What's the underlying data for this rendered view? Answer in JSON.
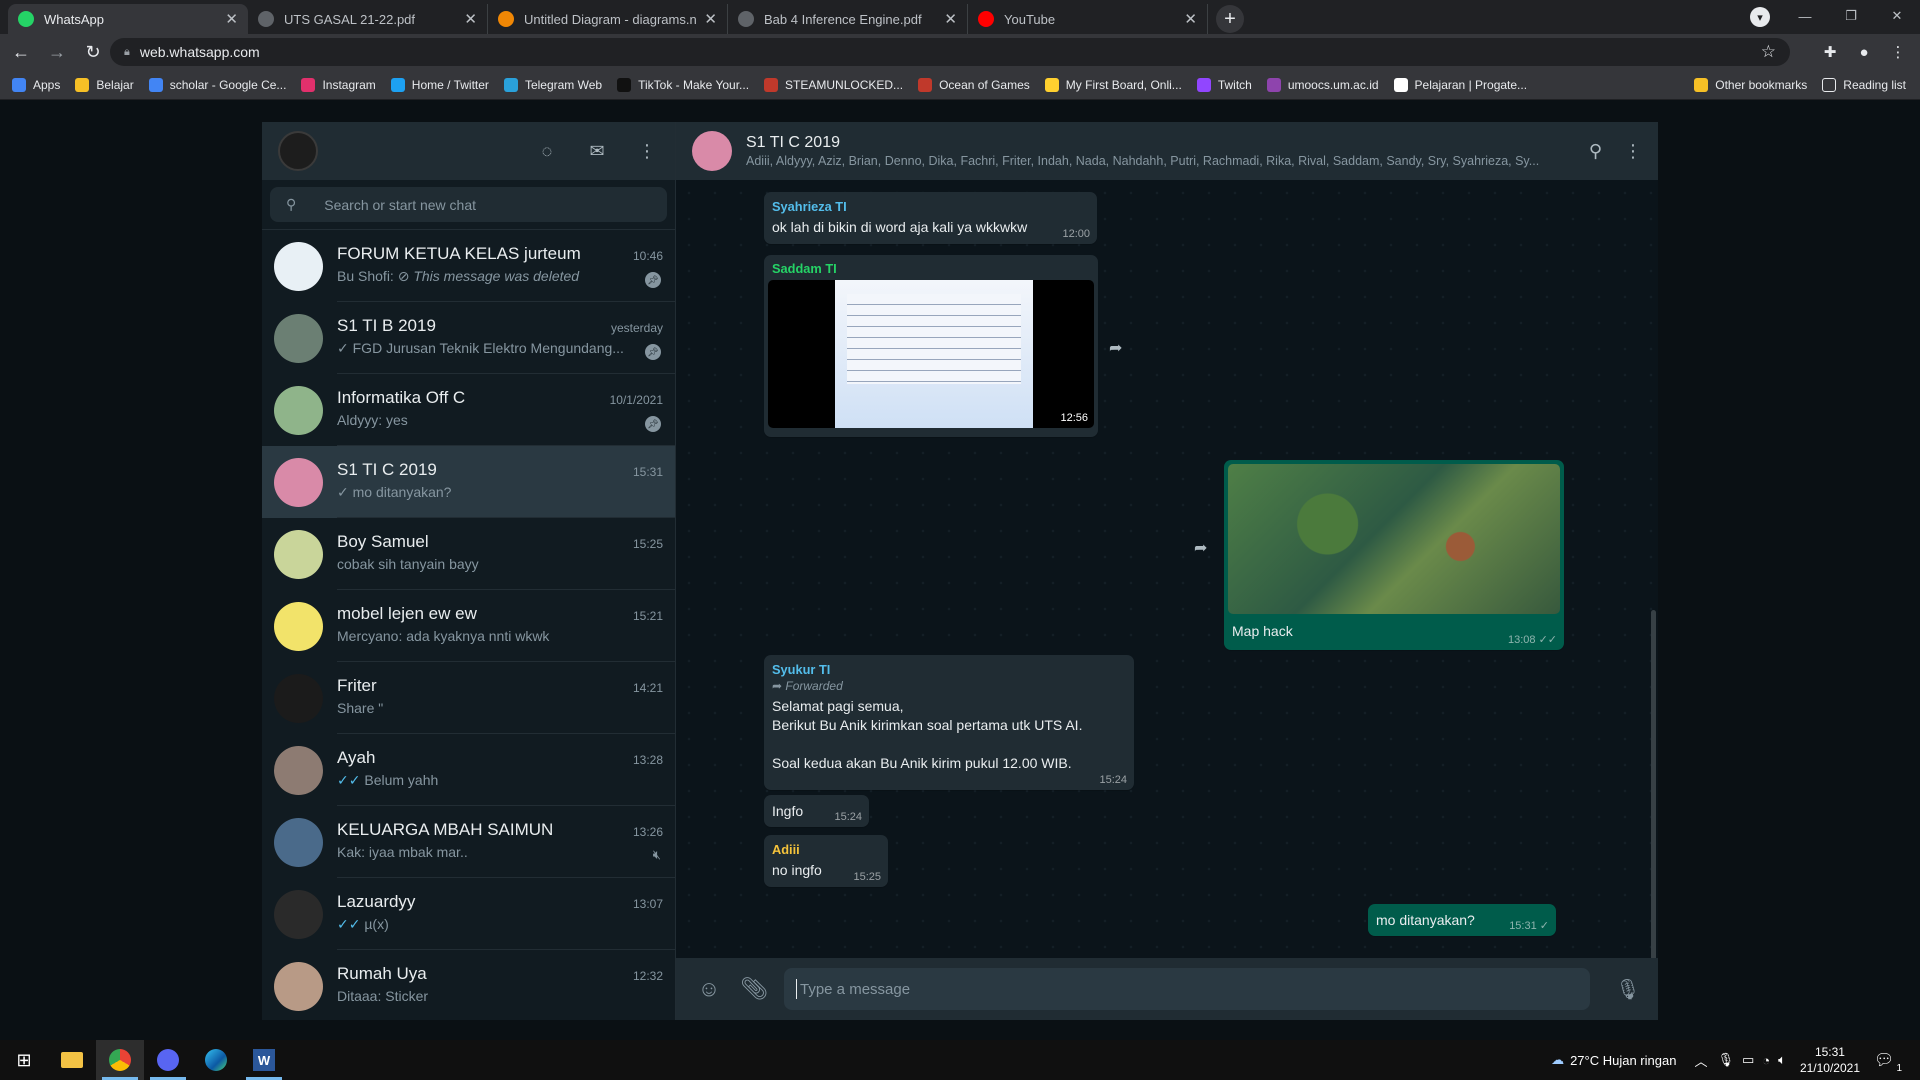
{
  "browser": {
    "tabs": [
      {
        "title": "WhatsApp",
        "icon": "whatsapp-icon",
        "color": "#25d366",
        "active": true
      },
      {
        "title": "UTS GASAL 21-22.pdf",
        "icon": "globe-icon",
        "color": "#5f6368",
        "active": false
      },
      {
        "title": "Untitled Diagram - diagrams.net",
        "icon": "drawio-icon",
        "color": "#f08705",
        "active": false
      },
      {
        "title": "Bab 4 Inference Engine.pdf",
        "icon": "globe-icon",
        "color": "#5f6368",
        "active": false
      },
      {
        "title": "YouTube",
        "icon": "youtube-icon",
        "color": "#ff0000",
        "active": false
      }
    ],
    "new_tab": "+",
    "url": "web.whatsapp.com",
    "bookmarks": [
      {
        "label": "Apps",
        "icon": "apps-grid-icon",
        "color": "#4285f4"
      },
      {
        "label": "Belajar",
        "icon": "folder-icon",
        "color": "#f6c026"
      },
      {
        "label": "scholar - Google Ce...",
        "icon": "scholar-icon",
        "color": "#4285f4"
      },
      {
        "label": "Instagram",
        "icon": "instagram-icon",
        "color": "#e1306c"
      },
      {
        "label": "Home / Twitter",
        "icon": "twitter-icon",
        "color": "#1da1f2"
      },
      {
        "label": "Telegram Web",
        "icon": "telegram-icon",
        "color": "#2aa1da"
      },
      {
        "label": "TikTok - Make Your...",
        "icon": "tiktok-icon",
        "color": "#111111"
      },
      {
        "label": "STEAMUNLOCKED...",
        "icon": "steam-icon",
        "color": "#c0392b"
      },
      {
        "label": "Ocean of Games",
        "icon": "game-icon",
        "color": "#c0392b"
      },
      {
        "label": "My First Board, Onli...",
        "icon": "miro-icon",
        "color": "#ffd02f"
      },
      {
        "label": "Twitch",
        "icon": "twitch-icon",
        "color": "#9146ff"
      },
      {
        "label": "umoocs.um.ac.id",
        "icon": "umoocs-icon",
        "color": "#8e44ad"
      },
      {
        "label": "Pelajaran | Progate...",
        "icon": "progate-icon",
        "color": "#ffffff"
      }
    ],
    "other_bookmarks": "Other bookmarks",
    "reading_list": "Reading list"
  },
  "sidebar": {
    "search_placeholder": "Search or start new chat",
    "chats": [
      {
        "name": "FORUM KETUA KELAS jurteum",
        "time": "10:46",
        "prefix": "Bu Shofi: ",
        "last": "This message was deleted",
        "status": "",
        "badge": "pin",
        "avatar": "#e8f0f5",
        "active": false
      },
      {
        "name": "S1 TI B 2019",
        "time": "yesterday",
        "prefix": "",
        "last": "FGD Jurusan Teknik Elektro Mengundang...",
        "status": "✓ ",
        "badge": "pin",
        "avatar": "#6b7f73",
        "active": false
      },
      {
        "name": "Informatika Off C",
        "time": "10/1/2021",
        "prefix": "",
        "last": "Aldyyy: yes",
        "status": "",
        "badge": "pin",
        "avatar": "#8fb48a",
        "active": false
      },
      {
        "name": "S1 TI C 2019",
        "time": "15:31",
        "prefix": "",
        "last": "mo ditanyakan?",
        "status": "✓ ",
        "badge": "",
        "avatar": "#d98aa8",
        "active": true
      },
      {
        "name": "Boy Samuel",
        "time": "15:25",
        "prefix": "",
        "last": "cobak sih tanyain bayy",
        "status": "",
        "badge": "",
        "avatar": "#c9d59a",
        "active": false
      },
      {
        "name": "mobel lejen ew ew",
        "time": "15:21",
        "prefix": "",
        "last": "Mercyano: ada kyaknya nnti wkwk",
        "status": "",
        "badge": "",
        "avatar": "#f2e36a",
        "active": false
      },
      {
        "name": "Friter",
        "time": "14:21",
        "prefix": "",
        "last": "Share \"",
        "status": "",
        "badge": "",
        "avatar": "#1b1b1b",
        "active": false
      },
      {
        "name": "Ayah",
        "time": "13:28",
        "prefix": "",
        "last": "Belum yahh",
        "status": "✓✓ ",
        "badge": "",
        "avatar": "#8d7b72",
        "active": false
      },
      {
        "name": "KELUARGA MBAH SAIMUN",
        "time": "13:26",
        "prefix": "",
        "last": "Kak: iyaa mbak mar..",
        "status": "",
        "badge": "mute",
        "avatar": "#4a6a8a",
        "active": false
      },
      {
        "name": "Lazuardyy",
        "time": "13:07",
        "prefix": "",
        "last": "µ(x)",
        "status": "✓✓ ",
        "badge": "",
        "avatar": "#2a2a2a",
        "active": false
      },
      {
        "name": "Rumah Uya",
        "time": "12:32",
        "prefix": "",
        "last": "Ditaaa: Sticker",
        "status": "",
        "badge": "",
        "avatar": "#b89a86",
        "active": false
      }
    ]
  },
  "conversation": {
    "name": "S1 TI C 2019",
    "members": "Adiii, Aldyyy, Aziz, Brian, Denno, Dika, Fachri, Friter, Indah, Nada, Nahdahh, Putri, Rachmadi, Rika, Rival, Saddam, Sandy, Sry, Syahrieza, Sy...",
    "messages": [
      {
        "sender": "Syahrieza TI",
        "sender_color": "#53bdeb",
        "text": "ok lah di bikin di word aja kali ya wkkwkw",
        "time": "12:00"
      },
      {
        "sender": "Saddam TI",
        "sender_color": "#25d366",
        "video_duration": "12:56"
      },
      {
        "caption": "Map hack",
        "time": "13:08"
      },
      {
        "sender": "Syukur TI",
        "sender_color": "#53bdeb",
        "forwarded": "Forwarded",
        "text": "Selamat pagi semua,\nBerikut Bu Anik kirimkan soal pertama utk UTS AI.\n\nSoal kedua akan Bu Anik kirim pukul 12.00 WIB.",
        "time": "15:24"
      },
      {
        "text": "Ingfo",
        "time": "15:24"
      },
      {
        "sender": "Adiii",
        "sender_color": "#f5c33b",
        "text": "no ingfo",
        "time": "15:25"
      },
      {
        "text": "mo ditanyakan?",
        "time": "15:31"
      }
    ],
    "compose_placeholder": "Type a message"
  },
  "taskbar": {
    "weather": "27°C  Hujan ringan",
    "time": "15:31",
    "date": "21/10/2021",
    "notif_count": "1"
  }
}
